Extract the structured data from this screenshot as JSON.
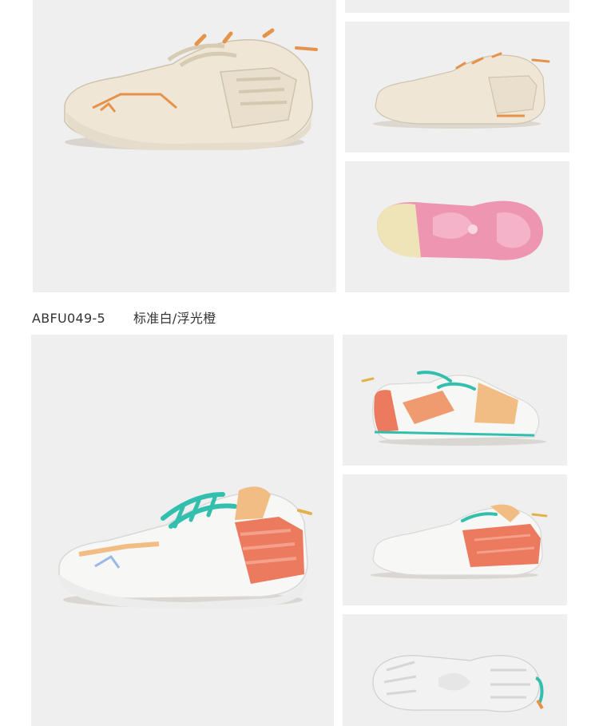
{
  "variant": {
    "code": "ABFU049-5",
    "color_name": "标准白/浮光橙"
  },
  "colors": {
    "panel_bg": "#efefef",
    "cream": "#efe6d6",
    "orange": "#e5934a",
    "pink": "#ee95b2",
    "teal": "#33bfae",
    "coral": "#ec7a5e",
    "peach": "#f2bd85"
  },
  "images": [
    {
      "label": "cream-shoe-side-view"
    },
    {
      "label": "cream-shoe-medial-view"
    },
    {
      "label": "cream-shoe-outsole-view"
    },
    {
      "label": "white-orange-shoe-side-view"
    },
    {
      "label": "white-orange-shoe-lateral-view"
    },
    {
      "label": "white-orange-shoe-medial-view"
    },
    {
      "label": "white-orange-shoe-outsole-view"
    }
  ]
}
